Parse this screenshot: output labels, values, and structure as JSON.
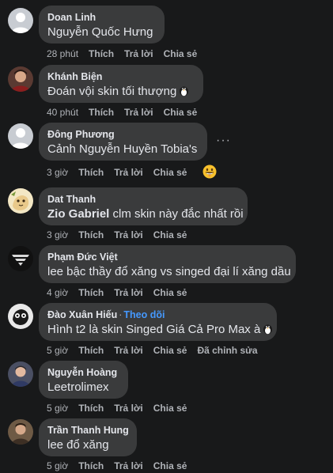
{
  "actions": {
    "like": "Thích",
    "reply": "Trả lời",
    "share": "Chia sẻ"
  },
  "comments": [
    {
      "author": "Doan Linh",
      "text": "Nguyễn Quốc Hưng",
      "time": "28 phút"
    },
    {
      "author": "Khánh Biện",
      "text": "Đoán vội skin tối thượng",
      "time": "40 phút"
    },
    {
      "author": "Đông Phương",
      "text": "Cảnh Nguyễn Huyền Tobia's",
      "time": "3 giờ"
    },
    {
      "author": "Dat Thanh",
      "tag": "Zio Gabriel",
      "text": " clm skin này đắc nhất rồi",
      "time": "3 giờ"
    },
    {
      "author": "Phạm Đức Việt",
      "text": "lee bậc thầy đổ xăng vs singed đại lí xăng dầu",
      "time": "4 giờ"
    },
    {
      "author": "Đào Xuân Hiếu",
      "follow": "Theo dõi",
      "separator": "·",
      "text": "Hình t2 là skin Singed Giá Cả Pro Max à",
      "time": "5 giờ",
      "edited": "Đã chỉnh sửa"
    },
    {
      "author": "Nguyễn Hoàng",
      "text": "Leetrolimex",
      "time": "5 giờ"
    },
    {
      "author": "Trần Thanh Hung",
      "text": "lee đổ xăng",
      "time": "5 giờ"
    }
  ],
  "more_label": "···",
  "colors": {
    "bubble": "#3a3b3c",
    "background": "#18191a",
    "follow_link": "#4599ff"
  },
  "icons": [
    "penguin-emoji-icon",
    "more-options-icon",
    "grinning-emoji-icon"
  ]
}
